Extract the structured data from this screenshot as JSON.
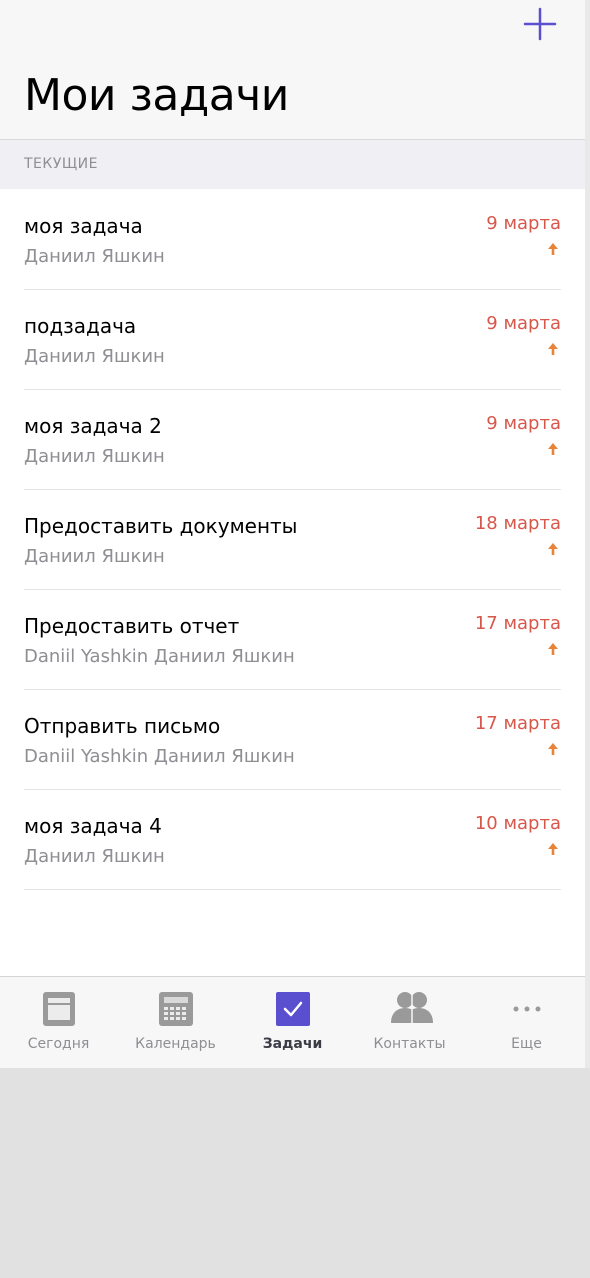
{
  "header": {
    "title": "Мои задачи",
    "add_icon": "plus-icon"
  },
  "section": {
    "label": "ТЕКУЩИЕ"
  },
  "tasks": [
    {
      "title": "моя задача",
      "assignee": "Даниил Яшкин",
      "date": "9 марта",
      "priority_icon": "arrow-up-icon"
    },
    {
      "title": "подзадача",
      "assignee": "Даниил Яшкин",
      "date": "9 марта",
      "priority_icon": "arrow-up-icon"
    },
    {
      "title": "моя задача 2",
      "assignee": "Даниил Яшкин",
      "date": "9 марта",
      "priority_icon": "arrow-up-icon"
    },
    {
      "title": "Предоставить документы",
      "assignee": "Даниил Яшкин",
      "date": "18 марта",
      "priority_icon": "arrow-up-icon"
    },
    {
      "title": "Предоставить отчет",
      "assignee": "Daniil Yashkin Даниил Яшкин",
      "date": "17 марта",
      "priority_icon": "arrow-up-icon"
    },
    {
      "title": "Отправить письмо",
      "assignee": "Daniil Yashkin Даниил Яшкин",
      "date": "17 марта",
      "priority_icon": "arrow-up-icon"
    },
    {
      "title": "моя задача 4",
      "assignee": "Даниил Яшкин",
      "date": "10 марта",
      "priority_icon": "arrow-up-icon"
    }
  ],
  "tab_bar": {
    "tabs": [
      {
        "label": "Сегодня",
        "icon": "today-icon",
        "active": false
      },
      {
        "label": "Календарь",
        "icon": "calendar-icon",
        "active": false
      },
      {
        "label": "Задачи",
        "icon": "tasks-checkbox-icon",
        "active": true
      },
      {
        "label": "Контакты",
        "icon": "contacts-icon",
        "active": false
      },
      {
        "label": "Еще",
        "icon": "more-icon",
        "active": false
      }
    ]
  },
  "colors": {
    "accent": "#5a4fcf",
    "date": "#d7574a",
    "priority": "#e8833a",
    "secondary_text": "#8e8e93",
    "tab_inactive_icon": "#9a9a9a"
  }
}
